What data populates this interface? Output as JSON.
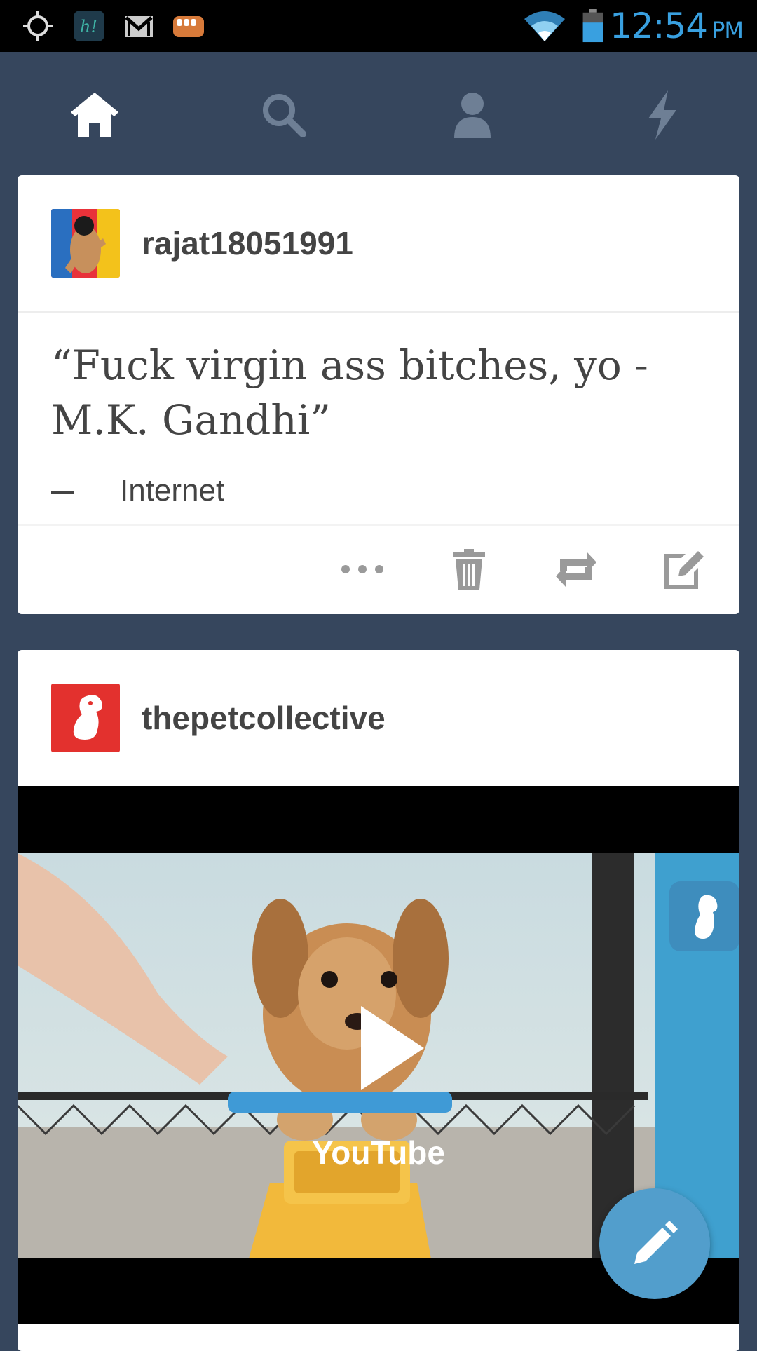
{
  "status_bar": {
    "time": "12:54",
    "ampm": "PM",
    "icons": [
      "location-icon",
      "hike-app-icon",
      "gmail-icon",
      "fist-app-icon",
      "wifi-icon",
      "battery-icon"
    ]
  },
  "nav": {
    "items": [
      {
        "name": "home-icon",
        "active": true
      },
      {
        "name": "search-icon",
        "active": false
      },
      {
        "name": "account-icon",
        "active": false
      },
      {
        "name": "activity-icon",
        "active": false
      }
    ]
  },
  "posts": [
    {
      "blog_name": "rajat18051991",
      "quote_text": "“Fuck virgin ass bitches, yo -M.K. Gandhi”",
      "quote_source": "Internet",
      "actions": [
        "more-icon",
        "delete-icon",
        "reblog-icon",
        "edit-icon"
      ]
    },
    {
      "blog_name": "thepetcollective",
      "video_provider": "YouTube"
    }
  ],
  "colors": {
    "background": "#36465d",
    "accent": "#529ecc",
    "status_time": "#39a0e0"
  }
}
